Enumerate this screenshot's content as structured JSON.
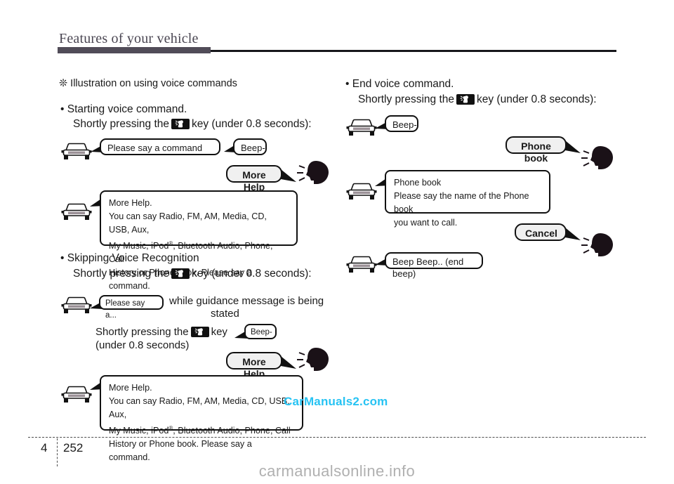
{
  "header": {
    "title": "Features of your vehicle"
  },
  "left_column": {
    "section_note": "❊ Illustration on using voice commands",
    "blocks": [
      {
        "bullet": "• Starting voice command.",
        "instruction_pre": "Shortly pressing the",
        "instruction_post": "key (under 0.8 seconds):",
        "car_bubble_1": "Please say a command",
        "beep_bubble": "Beep-",
        "user_bubble": "More Help",
        "help_title": "More Help.",
        "help_line1": "You can say Radio, FM, AM, Media, CD, USB, Aux,",
        "help_line2_a": "My  Music,  iPod",
        "help_line2_reg": "®",
        "help_line2_b": ",  Bluetooth  Audio,  Phone,  Call",
        "help_line3": "History or Phone book. Please say a command."
      },
      {
        "bullet": "• Skipping Voice Recognition",
        "instruction_pre": "Shortly pressing the",
        "instruction_post": "key (under 0.8 seconds):",
        "car_bubble_1": "Please say a...",
        "while_text_line1": "while  guidance  message  is  being",
        "while_text_line2": "stated",
        "press_pre": "Shortly pressing the",
        "press_post": "key",
        "press_line2": "(under 0.8 seconds)",
        "beep_bubble": "Beep-",
        "user_bubble": "More Help",
        "help_title": "More Help.",
        "help_line1": "You can say Radio, FM, AM, Media, CD, USB, Aux,",
        "help_line2_a": "My  Music,  iPod",
        "help_line2_reg": "®",
        "help_line2_b": ",  Bluetooth  Audio,  Phone,  Call",
        "help_line3": "History or Phone book. Please say a command."
      }
    ]
  },
  "right_column": {
    "bullet": "• End voice command.",
    "instruction_pre": "Shortly pressing the",
    "instruction_post": "key (under 0.8 seconds):",
    "beep_bubble": "Beep-",
    "user_bubble_1": "Phone book",
    "car_bubble_title": "Phone book",
    "car_bubble_line1": "Please say the name of the Phone book",
    "car_bubble_line2": "you want to call.",
    "user_bubble_2": "Cancel",
    "end_beep_bubble": "Beep Beep.. (end beep)"
  },
  "watermarks": {
    "inline": "CarManuals2.com",
    "bottom": "carmanualsonline.info"
  },
  "footer": {
    "chapter": "4",
    "page": "252"
  },
  "icons": {
    "car": "car-front-icon",
    "head": "speaking-head-icon",
    "voice_key": "voice-recognition-key-icon"
  },
  "colors": {
    "header_bar": "#514c58",
    "rule": "#17171b",
    "bubble_gray": "#f0f0f0",
    "watermark_cyan": "#27c3f3",
    "watermark_gray": "#b0b0b0"
  }
}
